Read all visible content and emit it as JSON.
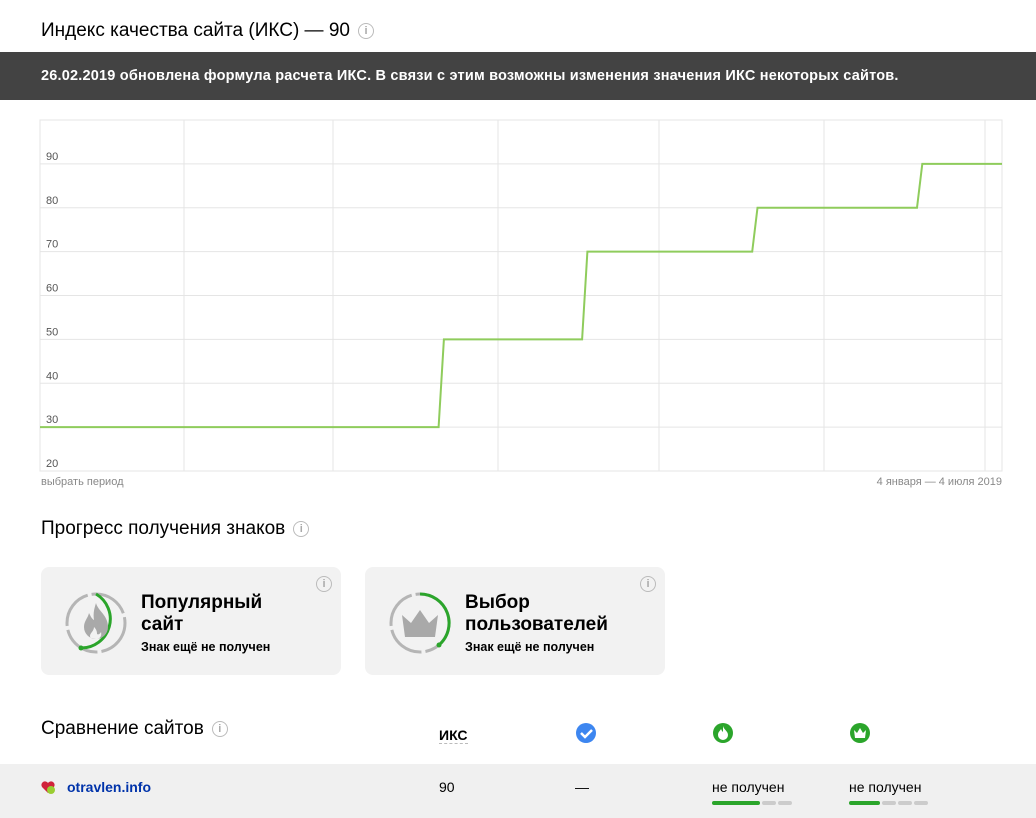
{
  "title": "Индекс качества сайта (ИКС) — 90",
  "banner": "26.02.2019 обновлена формула расчета ИКС. В связи с этим возможны изменения значения ИКС некоторых сайтов.",
  "period_link": "выбрать период",
  "period_range": "4 января — 4 июля 2019",
  "chart_data": {
    "type": "line",
    "title": "",
    "xlabel": "",
    "ylabel": "",
    "ylim": [
      20,
      100
    ],
    "yticks": [
      "20",
      "30",
      "40",
      "50",
      "60",
      "70",
      "80",
      "90"
    ],
    "x_range": [
      "2019-01-04",
      "2019-07-04"
    ],
    "line_color": "#8fcc5c",
    "grid": true,
    "points": [
      {
        "date": "2019-01-04",
        "value": 30
      },
      {
        "date": "2019-03-20",
        "value": 30
      },
      {
        "date": "2019-03-21",
        "value": 50
      },
      {
        "date": "2019-04-16",
        "value": 50
      },
      {
        "date": "2019-04-17",
        "value": 70
      },
      {
        "date": "2019-05-18",
        "value": 70
      },
      {
        "date": "2019-05-19",
        "value": 80
      },
      {
        "date": "2019-06-18",
        "value": 80
      },
      {
        "date": "2019-06-19",
        "value": 90
      },
      {
        "date": "2019-07-04",
        "value": 90
      }
    ]
  },
  "badges": {
    "heading": "Прогресс получения знаков",
    "items": [
      {
        "title": "Популярный сайт",
        "status": "Знак ещё не получен",
        "icon": "fire-icon",
        "progress": 0.5
      },
      {
        "title": "Выбор пользователей",
        "status": "Знак ещё не получен",
        "icon": "crown-icon",
        "progress": 0.4
      }
    ]
  },
  "compare": {
    "heading": "Сравнение сайтов",
    "col_iks": "ИКС",
    "rows": [
      {
        "site": "otravlen.info",
        "iks": "90",
        "verified": "—",
        "popular": "не получен",
        "choice": "не получен"
      }
    ]
  },
  "colors": {
    "green": "#2ba52b",
    "blue": "#3d86f0",
    "link": "#0033aa"
  }
}
